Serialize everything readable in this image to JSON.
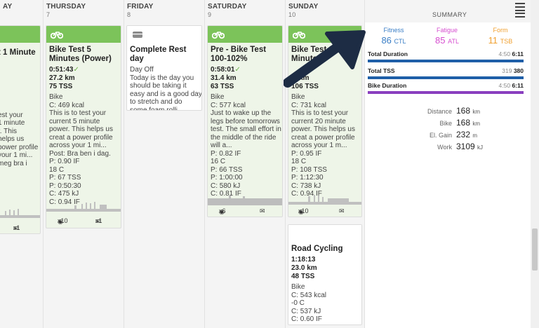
{
  "columns": [
    {
      "day": "AY",
      "num": ""
    },
    {
      "day": "THURSDAY",
      "num": "7"
    },
    {
      "day": "FRIDAY",
      "num": "8"
    },
    {
      "day": "SATURDAY",
      "num": "9"
    },
    {
      "day": "SUNDAY",
      "num": "10"
    }
  ],
  "wed_card": {
    "title": "t 1 Minute",
    "lines": [
      "l",
      "est your",
      "1 minute",
      "r. This",
      "helps us",
      "power profile",
      "your 1 mi...",
      "meg bra i"
    ],
    "comments": "x1"
  },
  "thu_card": {
    "title": "Bike Test 5 Minutes (Power)",
    "duration": "0:51:43",
    "distance": "27.2 km",
    "tss": "75 TSS",
    "lines": [
      "Bike",
      "C: 469 kcal",
      "This is to test your",
      "current 5 minute",
      "power. This helps us",
      "creat a power profile",
      "across your 1 mi...",
      "Post: Bra ben i dag.",
      "P: 0.90 IF",
      "18 C",
      "P: 67 TSS",
      "P: 0:50:30",
      "C: 475 kJ",
      "C: 0.94 IF"
    ],
    "bikes": "x10",
    "comments": "x1"
  },
  "fri_card": {
    "title": "Complete Rest day",
    "lines": [
      "Day Off",
      "Today is the day you",
      "should be taking it",
      "easy and is a good day",
      "to stretch and do",
      "some foam rolli..."
    ]
  },
  "sat_card": {
    "title": "Pre - Bike Test 100-102%",
    "duration": "0:58:01",
    "distance": "31.4 km",
    "tss": "63 TSS",
    "lines": [
      "Bike",
      "C: 577 kcal",
      "Just to wake up the",
      "legs before tomorrows",
      "test. The small effort in",
      "the middle of the ride",
      "will a...",
      "P: 0.82 IF",
      "16 C",
      "P: 66 TSS",
      "P: 1:00:00",
      "C: 580 kJ",
      "C: 0.81 IF"
    ],
    "bikes": "x6"
  },
  "sun_card": {
    "title": "Bike Test 1 Minute",
    "distance": "... km",
    "tss": "106 TSS",
    "lines": [
      "Bike",
      "C: 731 kcal",
      "This is to test your",
      "current 20 minute",
      "power. This helps us",
      "creat a power profile",
      "across your 1 m...",
      "P: 0.95 IF",
      "18 C",
      "P: 108 TSS",
      "P: 1:12:30",
      "C: 738 kJ",
      "C: 0.94 IF"
    ],
    "bikes": "x10"
  },
  "road_card": {
    "title": "Road Cycling",
    "duration": "1:18:13",
    "distance": "23.0 km",
    "tss": "48 TSS",
    "lines": [
      "Bike",
      "C: 543 kcal",
      "-0 C",
      "C: 537 kJ",
      "C: 0.60 IF"
    ]
  },
  "summary": {
    "title": "SUMMARY",
    "fitness": {
      "label": "Fitness",
      "value": "86",
      "unit": "CTL",
      "color": "#3a7ec6"
    },
    "fatigue": {
      "label": "Fatigue",
      "value": "85",
      "unit": "ATL",
      "color": "#d64fd0"
    },
    "form": {
      "label": "Form",
      "value": "11",
      "unit": "TSB",
      "color": "#f0a030"
    },
    "metrics": [
      {
        "label": "Total Duration",
        "planned": "4:50",
        "done": "6:11",
        "fill": 1.0,
        "color": "#1f5fa8"
      },
      {
        "label": "Total TSS",
        "planned": "319",
        "done": "380",
        "fill": 1.0,
        "color": "#1f5fa8"
      },
      {
        "label": "Bike Duration",
        "planned": "4:50",
        "done": "6:11",
        "fill": 1.0,
        "color": "#8a3fbf"
      }
    ],
    "stats": [
      {
        "label": "Distance",
        "value": "168",
        "unit": "km"
      },
      {
        "label": "Bike",
        "value": "168",
        "unit": "km"
      },
      {
        "label": "El. Gain",
        "value": "232",
        "unit": "m"
      },
      {
        "label": "Work",
        "value": "3109",
        "unit": "kJ"
      }
    ]
  }
}
